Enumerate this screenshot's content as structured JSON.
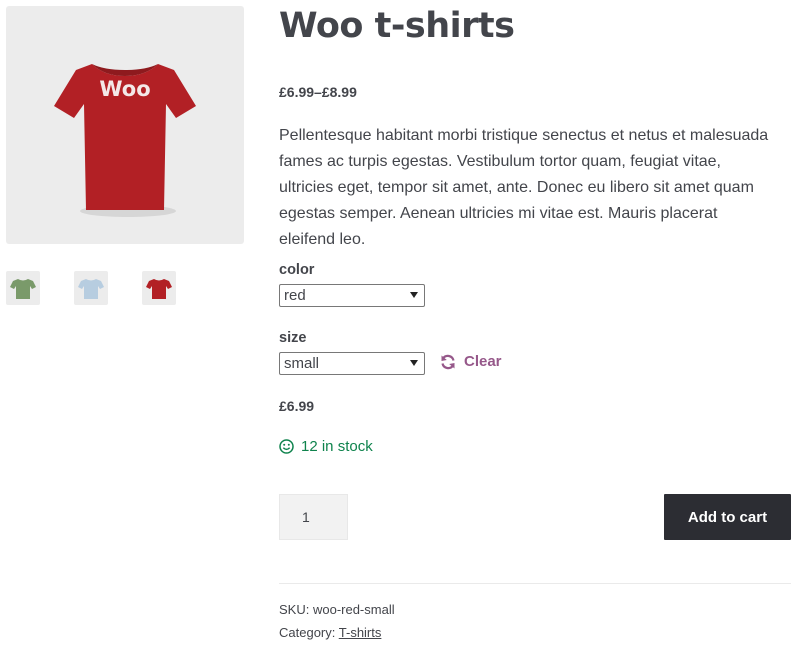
{
  "product": {
    "title": "Woo t-shirts",
    "price_range": "£6.99–£8.99",
    "description": "Pellentesque habitant morbi tristique senectus et netus et malesuada fames ac turpis egestas. Vestibulum tortor quam, feugiat vitae, ultricies eget, tempor sit amet, ante. Donec eu libero sit amet quam egestas semper. Aenean ultricies mi vitae est. Mauris placerat eleifend leo.",
    "image_logo_text": "Woo",
    "thumbnails": [
      {
        "name": "green",
        "color": "#7a9a6a"
      },
      {
        "name": "light-blue",
        "color": "#b7cde0"
      },
      {
        "name": "red",
        "color": "#b22025"
      }
    ],
    "main_shirt_color": "#b22025"
  },
  "variations": {
    "color_label": "color",
    "color_value": "red",
    "size_label": "size",
    "size_value": "small",
    "clear_label": "Clear"
  },
  "selected": {
    "price": "£6.99",
    "stock": "12 in stock"
  },
  "cart": {
    "quantity": "1",
    "add_label": "Add to cart"
  },
  "meta": {
    "sku_label": "SKU:",
    "sku_value": "woo-red-small",
    "category_label": "Category:",
    "category_value": "T-shirts"
  },
  "colors": {
    "accent": "#96588a",
    "stock_green": "#0f834d",
    "button_dark": "#2c2d33"
  }
}
